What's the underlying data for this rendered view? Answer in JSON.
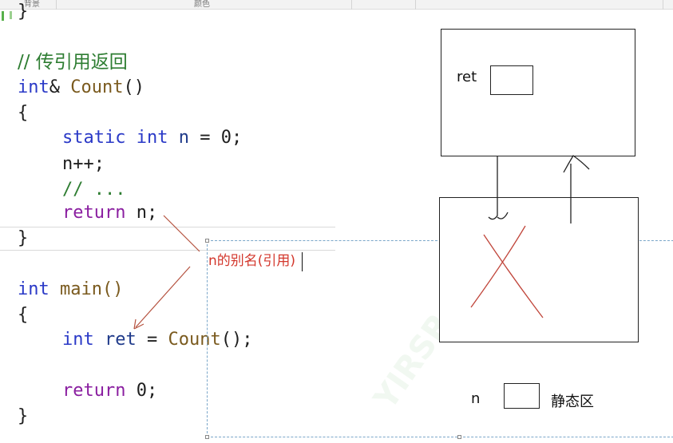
{
  "toolbar": {
    "label_left": "背景",
    "label_mid": "颜色"
  },
  "code": {
    "prev_brace": "}",
    "comment_line": "// 传引用返回",
    "fn_return_type": "int",
    "fn_ref": "&",
    "fn_name": "Count",
    "fn_parens": "()",
    "open1": "{",
    "static_kw": "static",
    "int_kw": "int",
    "n_var": "n",
    "assign_zero": " = 0;",
    "incr": "n++;",
    "ellipsis_comment": "// ...",
    "return_kw": "return",
    "ret_n": " n;",
    "close1": "}",
    "main_type": "int",
    "main_name": "main()",
    "open2": "{",
    "int_kw2": "int",
    "ret_var": "ret",
    "eq": " = ",
    "count_call": "Count",
    "call_end": "();",
    "return_kw2": "return",
    "ret_zero": " 0;",
    "close2": "}"
  },
  "annotation": {
    "note": "n的别名(引用)"
  },
  "diagram": {
    "ret_label": "ret",
    "n_label": "n",
    "static_label": "静态区"
  },
  "colors": {
    "keyword": "#2a39c7",
    "control": "#8a1ea0",
    "comment": "#2e7d32",
    "annotation": "#d3372c"
  }
}
